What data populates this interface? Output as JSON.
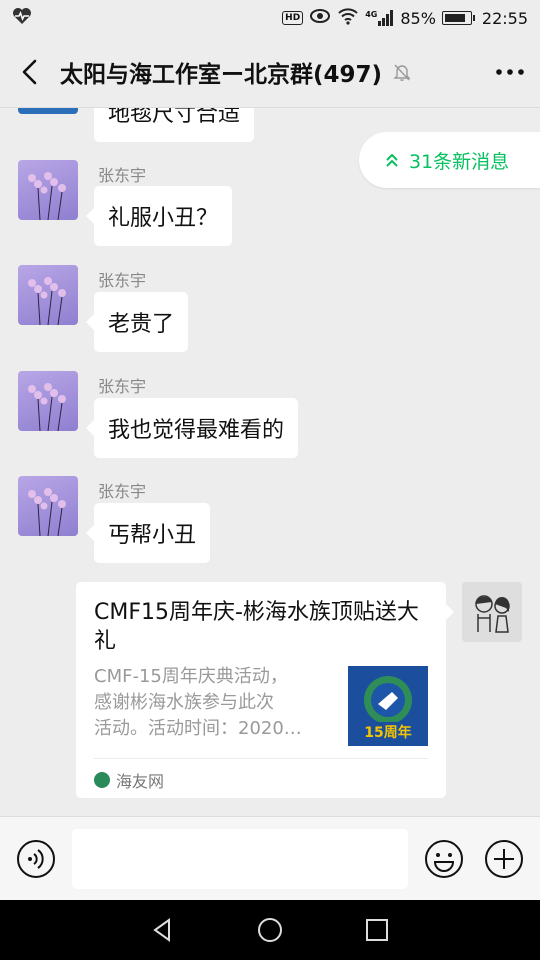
{
  "status_bar": {
    "hd_label": "HD",
    "network_label": "4G",
    "battery_percent": "85%",
    "battery_level": 0.85,
    "time": "22:55",
    "icons": [
      "heart-rate-icon",
      "eye-icon",
      "wifi-icon",
      "signal-icon",
      "battery-icon"
    ]
  },
  "header": {
    "title": "太阳与海工作室ー北京群(497)",
    "back_icon": "chevron-left-icon",
    "mute_icon": "bell-off-icon",
    "more_icon": "more-dots-icon"
  },
  "chat": {
    "partial_message": "地毯尺寸合适",
    "new_messages_label": "31条新消息",
    "messages": [
      {
        "sender": "张东宇",
        "text": "礼服小丑？"
      },
      {
        "sender": "张东宇",
        "text": "老贵了"
      },
      {
        "sender": "张东宇",
        "text": "我也觉得最难看的"
      },
      {
        "sender": "张东宇",
        "text": "丐帮小丑"
      }
    ],
    "link_card": {
      "title": "CMF15周年庆-彬海水族顶贴送大礼",
      "description": "CMF-15周年庆典活动，\n感谢彬海水族参与此次\n活动。活动时间：2020…",
      "thumbnail_text": "15周年",
      "source": "海友网"
    }
  },
  "input_bar": {
    "voice_icon": "voice-icon",
    "emoji_icon": "emoji-icon",
    "plus_icon": "plus-icon",
    "input_value": ""
  },
  "colors": {
    "background": "#ededed",
    "accent_green": "#07c160",
    "bubble_white": "#ffffff"
  }
}
